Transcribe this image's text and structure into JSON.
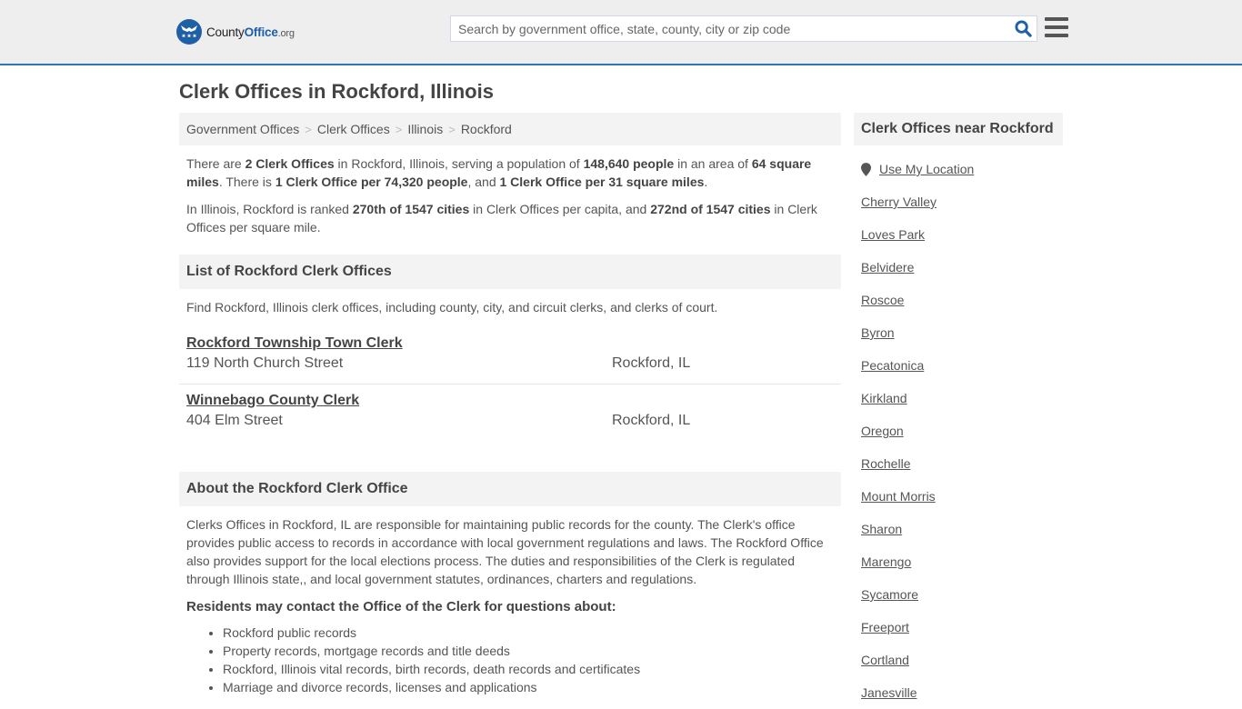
{
  "header": {
    "logo": {
      "name_part1": "County",
      "name_part2": "Office",
      "name_part3": ".org"
    },
    "search": {
      "placeholder": "Search by government office, state, county, city or zip code",
      "value": ""
    },
    "icons": {
      "search": "search-icon",
      "menu": "hamburger-menu-icon"
    },
    "accent_color": "#2e75b6"
  },
  "page": {
    "title": "Clerk Offices in Rockford, Illinois"
  },
  "breadcrumb": [
    {
      "label": "Government Offices"
    },
    {
      "label": "Clerk Offices"
    },
    {
      "label": "Illinois"
    },
    {
      "label": "Rockford"
    }
  ],
  "breadcrumb_separator": ">",
  "summary": {
    "p1": {
      "t1": "There are ",
      "b1": "2 Clerk Offices",
      "t2": " in Rockford, Illinois, serving a population of ",
      "b2": "148,640 people",
      "t3": " in an area of ",
      "b3": "64 square miles",
      "t4": ". There is ",
      "b4": "1 Clerk Office per 74,320 people",
      "t5": ", and ",
      "b5": "1 Clerk Office per 31 square miles",
      "t6": "."
    },
    "p2": {
      "t1": "In Illinois, Rockford is ranked ",
      "b1": "270th of 1547 cities",
      "t2": " in Clerk Offices per capita, and ",
      "b2": "272nd of 1547 cities",
      "t3": " in Clerk Offices per square mile."
    }
  },
  "list_section": {
    "heading": "List of Rockford Clerk Offices",
    "intro": "Find Rockford, Illinois clerk offices, including county, city, and circuit clerks, and clerks of court.",
    "offices": [
      {
        "name": "Rockford Township Town Clerk",
        "address": "119 North Church Street",
        "city": "Rockford, IL"
      },
      {
        "name": "Winnebago County Clerk",
        "address": "404 Elm Street",
        "city": "Rockford, IL"
      }
    ]
  },
  "about_section": {
    "heading": "About the Rockford Clerk Office",
    "body": "Clerks Offices in Rockford, IL are responsible for maintaining public records for the county. The Clerk's office provides public access to records in accordance with local government regulations and laws. The Rockford Office also provides support for the local elections process. The duties and responsibilities of the Clerk is regulated through Illinois state,, and local government statutes, ordinances, charters and regulations.",
    "residents_heading": "Residents may contact the Office of the Clerk for questions about:",
    "topics": [
      "Rockford public records",
      "Property records, mortgage records and title deeds",
      "Rockford, Illinois vital records, birth records, death records and certificates",
      "Marriage and divorce records, licenses and applications"
    ]
  },
  "sidebar": {
    "heading": "Clerk Offices near Rockford",
    "use_location": "Use My Location",
    "location_icon": "map-marker-icon",
    "nearby": [
      "Cherry Valley",
      "Loves Park",
      "Belvidere",
      "Roscoe",
      "Byron",
      "Pecatonica",
      "Kirkland",
      "Oregon",
      "Rochelle",
      "Mount Morris",
      "Sharon",
      "Marengo",
      "Sycamore",
      "Freeport",
      "Cortland",
      "Janesville"
    ]
  }
}
